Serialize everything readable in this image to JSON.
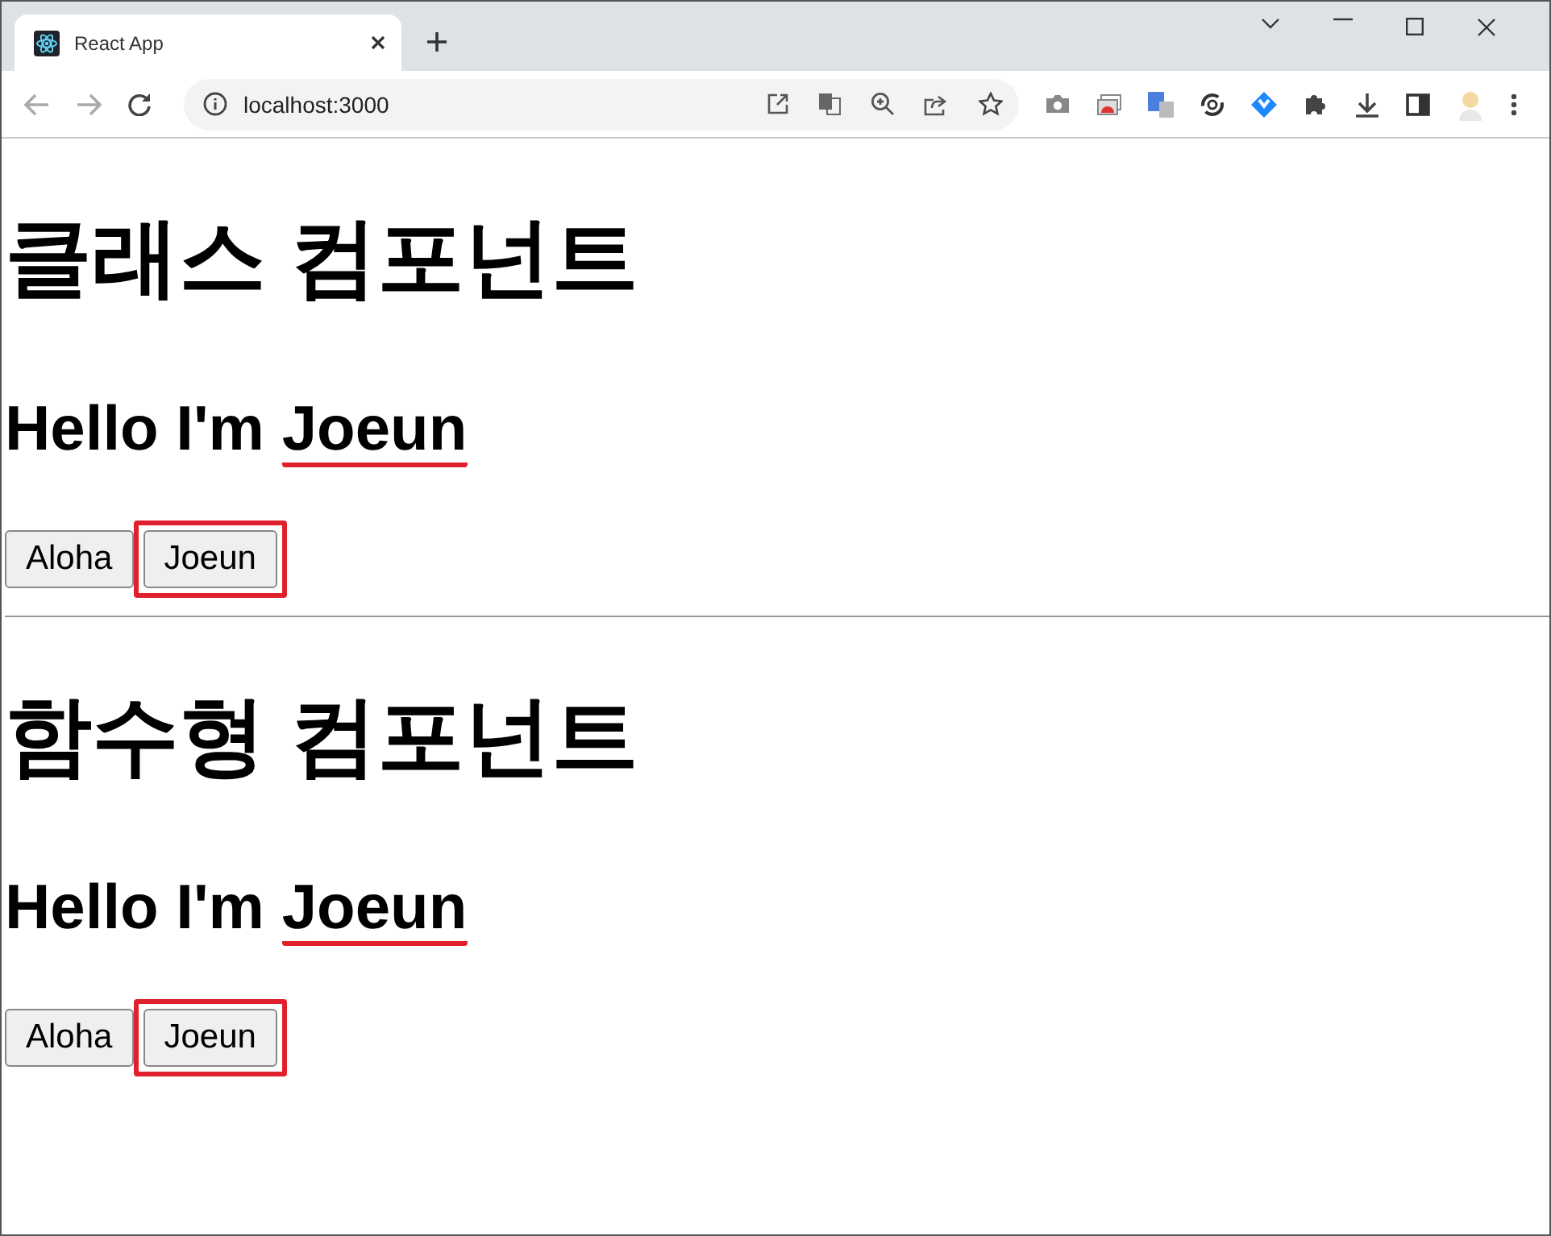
{
  "browser": {
    "tab": {
      "title": "React App",
      "selected": true
    },
    "address": "localhost:3000"
  },
  "sections": [
    {
      "title": "클래스 컴포넌트",
      "greeting": "Hello I'm ",
      "name": "Joeun",
      "name_underlined": true,
      "buttons": [
        {
          "label": "Aloha",
          "framed": false
        },
        {
          "label": "Joeun",
          "framed": true
        }
      ],
      "divider_after": true
    },
    {
      "title": "함수형 컴포넌트",
      "greeting": "Hello I'm ",
      "name": "Joeun",
      "name_underlined": true,
      "buttons": [
        {
          "label": "Aloha",
          "framed": false
        },
        {
          "label": "Joeun",
          "framed": true
        }
      ],
      "divider_after": false
    }
  ]
}
